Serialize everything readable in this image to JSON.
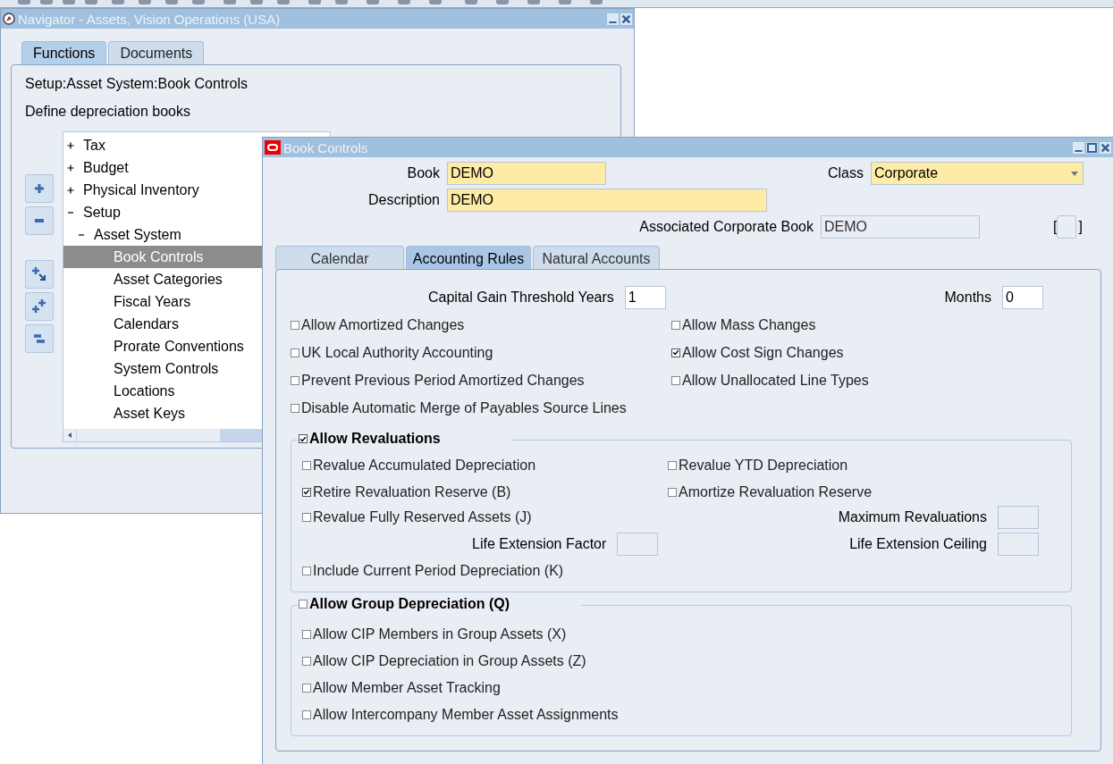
{
  "navigator": {
    "title": "Navigator - Assets, Vision Operations (USA)",
    "tabs": [
      {
        "label": "Functions",
        "selected": true
      },
      {
        "label": "Documents",
        "selected": false
      }
    ],
    "path": "Setup:Asset System:Book Controls",
    "description": "Define depreciation books",
    "tree": [
      {
        "label": "Tax",
        "expanded": false
      },
      {
        "label": "Budget",
        "expanded": false
      },
      {
        "label": "Physical Inventory",
        "expanded": false
      },
      {
        "label": "Setup",
        "expanded": true,
        "children": [
          {
            "label": "Asset System",
            "expanded": true,
            "children": [
              {
                "label": "Book Controls",
                "selected": true
              },
              {
                "label": "Asset Categories",
                "selected": false
              },
              {
                "label": "Fiscal Years",
                "selected": false
              },
              {
                "label": "Calendars",
                "selected": false
              },
              {
                "label": "Prorate Conventions",
                "selected": false
              },
              {
                "label": "System Controls",
                "selected": false
              },
              {
                "label": "Locations",
                "selected": false
              },
              {
                "label": "Asset Keys",
                "selected": false
              }
            ]
          }
        ]
      }
    ]
  },
  "book_controls": {
    "title": "Book Controls",
    "book": {
      "label": "Book",
      "value": "DEMO"
    },
    "class": {
      "label": "Class",
      "value": "Corporate"
    },
    "description": {
      "label": "Description",
      "value": "DEMO"
    },
    "associated_corporate_book": {
      "label": "Associated Corporate Book",
      "value": "DEMO"
    },
    "flexfield": {
      "open": "[",
      "close": "]"
    },
    "tabs": [
      {
        "label": "Calendar",
        "selected": false
      },
      {
        "label": "Accounting Rules",
        "selected": true
      },
      {
        "label": "Natural Accounts",
        "selected": false
      }
    ],
    "capital_gain_threshold_years": {
      "label": "Capital Gain Threshold Years",
      "value": "1"
    },
    "months": {
      "label": "Months",
      "value": "0"
    },
    "options": [
      {
        "label": "Allow Amortized Changes",
        "checked": false
      },
      {
        "label": "Allow Mass Changes",
        "checked": false
      },
      {
        "label": "UK Local Authority Accounting",
        "checked": false
      },
      {
        "label": "Allow Cost Sign Changes",
        "checked": true
      },
      {
        "label": "Prevent Previous Period Amortized Changes",
        "checked": false
      },
      {
        "label": "Allow Unallocated Line Types",
        "checked": false
      },
      {
        "label": "Disable Automatic Merge of Payables Source Lines",
        "checked": false
      }
    ],
    "revaluations": {
      "label": "Allow Revaluations",
      "checked": true,
      "options": [
        {
          "label": "Revalue Accumulated Depreciation",
          "checked": false
        },
        {
          "label": "Revalue YTD Depreciation",
          "checked": false
        },
        {
          "label": "Retire Revaluation Reserve (B)",
          "checked": true
        },
        {
          "label": "Amortize Revaluation Reserve",
          "checked": false
        },
        {
          "label": "Revalue Fully Reserved Assets (J)",
          "checked": false
        }
      ],
      "maximum_revaluations": {
        "label": "Maximum Revaluations"
      },
      "life_extension_factor": {
        "label": "Life Extension Factor"
      },
      "life_extension_ceiling": {
        "label": "Life Extension Ceiling"
      },
      "include_current": {
        "label": "Include Current Period Depreciation (K)",
        "checked": false
      }
    },
    "group_depreciation": {
      "label": "Allow Group Depreciation (Q)",
      "checked": false,
      "options": [
        {
          "label": "Allow CIP Members in Group Assets  (X)",
          "checked": false
        },
        {
          "label": "Allow CIP Depreciation in Group Assets (Z)",
          "checked": false
        },
        {
          "label": "Allow Member Asset Tracking",
          "checked": false
        },
        {
          "label": "Allow Intercompany Member Asset Assignments",
          "checked": false
        }
      ]
    }
  }
}
